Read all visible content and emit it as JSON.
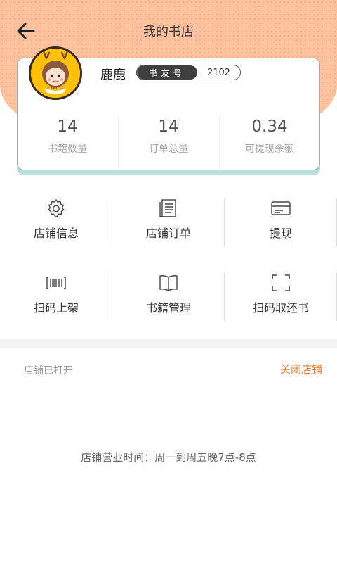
{
  "header": {
    "title": "我的书店",
    "back_icon": "arrow-left-icon"
  },
  "profile": {
    "username": "鹿鹿",
    "badge_label": "书友号",
    "badge_value": "2102",
    "avatar_text": "LULU"
  },
  "stats": [
    {
      "value": "14",
      "label": "书籍数量"
    },
    {
      "value": "14",
      "label": "订单总量"
    },
    {
      "value": "0.34",
      "label": "可提现余额"
    }
  ],
  "menu": [
    {
      "label": "店铺信息",
      "icon": "gear-icon"
    },
    {
      "label": "店铺订单",
      "icon": "document-icon"
    },
    {
      "label": "提现",
      "icon": "card-icon"
    },
    {
      "label": "扫码上架",
      "icon": "barcode-icon"
    },
    {
      "label": "书籍管理",
      "icon": "book-icon"
    },
    {
      "label": "扫码取还书",
      "icon": "scan-frame-icon"
    }
  ],
  "shop": {
    "status": "店铺已打开",
    "close_label": "关闭店铺",
    "hours": "店铺营业时间：周一到周五晚7点-8点"
  },
  "colors": {
    "hero": "#fdc2a0",
    "accent": "#f07b2e",
    "card_shadow": "#b9e1e2"
  }
}
